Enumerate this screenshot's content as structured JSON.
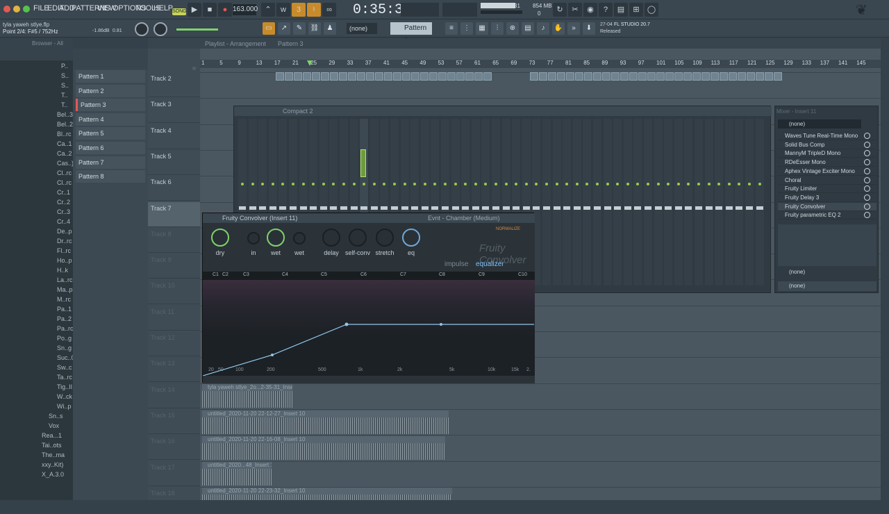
{
  "menu": [
    "FILE",
    "EDIT",
    "ADD",
    "PATTERNS",
    "VIEW",
    "OPTIONS",
    "TOOLS",
    "HELP"
  ],
  "transport": {
    "mode": "SONG",
    "tempo": "163.000",
    "time": "0:35:33",
    "cpu": "31",
    "mem": "854 MB",
    "mem2": "0"
  },
  "status": {
    "file": "tyla yaweh stlye.flp",
    "point": "Point 2/4: F#5 / 752Hz",
    "db": "-1.86dB",
    "val": "0.81"
  },
  "toolbar2": {
    "none": "(none)",
    "pattern": "Pattern 3",
    "hint_num": "27-04",
    "hint_app": "FL STUDIO 20.7",
    "hint_state": "Released"
  },
  "browser": {
    "title": "Browser - All",
    "items": [
      "P..",
      "S..",
      "S..",
      "T..",
      "T..",
      "Bel..3",
      "Bel..2",
      "Bl..rc",
      "Ca..1",
      "Ca..2",
      "Cas..)",
      "Cl..rc",
      "Cl..rc",
      "Cr..1",
      "Cr..2",
      "Cr..3",
      "Cr..4",
      "De..p",
      "Dr..rc",
      "Fl..rc",
      "Ho..p",
      "H..k",
      "La..rc",
      "Ma..p",
      "M..rc",
      "Pa..1",
      "Pa..2",
      "Pa..rc",
      "Po..g",
      "Sn..g",
      "Suc..0",
      "Sw..c",
      "Ta..rc",
      "Tig..II",
      "W..ck",
      "Wi..p",
      "Sn..s",
      "Vox",
      "Rea...1",
      "Tai..ots",
      "The..ma",
      "xxy..Kit)",
      "X_A.3.0"
    ]
  },
  "playlist": {
    "title": "Playlist - Arrangement",
    "pattern": "Pattern 3",
    "ruler": [
      "1",
      "5",
      "9",
      "13",
      "17",
      "21",
      "25",
      "29",
      "33",
      "37",
      "41",
      "45",
      "49",
      "53",
      "57",
      "61",
      "65",
      "69",
      "73",
      "77",
      "81",
      "85",
      "89",
      "93",
      "97",
      "101",
      "105",
      "109",
      "113",
      "117",
      "121",
      "125",
      "129",
      "133",
      "137",
      "141",
      "145"
    ]
  },
  "patterns": [
    "Pattern 1",
    "Pattern 2",
    "Pattern 3",
    "Pattern 4",
    "Pattern 5",
    "Pattern 6",
    "Pattern 7",
    "Pattern 8"
  ],
  "tracks": [
    "Track 2",
    "Track 3",
    "Track 4",
    "Track 5",
    "Track 6",
    "Track 7",
    "Track 8",
    "Track 9",
    "Track 10",
    "Track 11",
    "Track 12",
    "Track 13",
    "Track 14",
    "Track 15",
    "Track 16",
    "Track 17",
    "Track 18"
  ],
  "mixer": {
    "title": "Compact 2",
    "insert_title": "Mixer - Insert 11",
    "slot_none": "(none)",
    "send_none": "(none)",
    "out_none": "(none)",
    "slots": [
      "Waves Tune Real-Time Mono",
      "Solid Bus Comp",
      "MannyM TripleD Mono",
      "RDeEsser Mono",
      "Aphex Vintage Exciter Mono",
      "Choral",
      "Fruity Limiter",
      "Fruity Delay 3",
      "Fruity Convolver",
      "Fruity parametric EQ 2"
    ]
  },
  "convolver": {
    "title": "Fruity Convolver (Insert 11)",
    "preset": "Evnt - Chamber (Medium)",
    "normalize": "NORMALIZE",
    "logo": "Fruity Convolver",
    "tab_impulse": "impulse",
    "tab_eq": "equalizer",
    "knobs": [
      "dry",
      "in",
      "wet",
      "wet",
      "delay",
      "self-conv",
      "stretch",
      "eq"
    ],
    "markers": [
      "C1",
      "C2",
      "C3",
      "C4",
      "C5",
      "C6",
      "C7",
      "C8",
      "C9",
      "C10"
    ],
    "freqs": [
      "20",
      "50",
      "100",
      "200",
      "500",
      "1k",
      "2k",
      "5k",
      "10k",
      "15k",
      "2."
    ]
  },
  "audio_clips": [
    "tyla yaweh stlye_2o...2-35-31_Insert 10",
    "untitled_2020-11-20 22-12-27_Insert 10",
    "untitled_2020-11-20 22-16-08_Insert 10",
    "untitled_2020...48_Insert 10",
    "untitled_2020-11-20 22-23-32_Insert 10"
  ]
}
